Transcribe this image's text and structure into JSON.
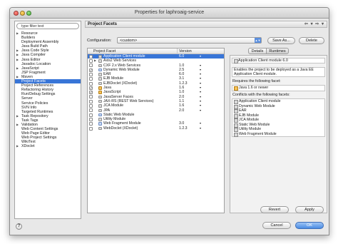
{
  "window": {
    "title": "Properties for laphroaig-service"
  },
  "filter": {
    "value": "type filter text"
  },
  "nav": {
    "items": [
      {
        "label": "Resource",
        "expandable": true
      },
      {
        "label": "Builders"
      },
      {
        "label": "Deployment Assembly"
      },
      {
        "label": "Java Build Path"
      },
      {
        "label": "Java Code Style",
        "expandable": true
      },
      {
        "label": "Java Compiler",
        "expandable": true
      },
      {
        "label": "Java Editor",
        "expandable": true
      },
      {
        "label": "Javadoc Location"
      },
      {
        "label": "JavaScript",
        "expandable": true
      },
      {
        "label": "JSP Fragment"
      },
      {
        "label": "Maven",
        "expandable": true
      },
      {
        "label": "Project Facets",
        "selected": true
      },
      {
        "label": "Project References"
      },
      {
        "label": "Refactoring History"
      },
      {
        "label": "Run/Debug Settings"
      },
      {
        "label": "Server"
      },
      {
        "label": "Service Policies"
      },
      {
        "label": "SVN Info"
      },
      {
        "label": "Targeted Runtimes"
      },
      {
        "label": "Task Repository",
        "expandable": true
      },
      {
        "label": "Task Tags"
      },
      {
        "label": "Validation",
        "expandable": true
      },
      {
        "label": "Web Content Settings"
      },
      {
        "label": "Web Page Editor"
      },
      {
        "label": "Web Project Settings"
      },
      {
        "label": "WikiText"
      },
      {
        "label": "XDoclet",
        "expandable": true
      }
    ]
  },
  "main": {
    "section_title": "Project Facets",
    "nav_arrows": "⇦ ▾ ⇨ ▾",
    "config_label": "Configuration:",
    "config_value": "<custom>",
    "save_as_label": "Save As...",
    "delete_label": "Delete",
    "table": {
      "col_facet": "Project Facet",
      "col_version": "Version",
      "rows": [
        {
          "label": "Application Client module",
          "version": "6.0",
          "checked": false,
          "selected": true,
          "icon": "facet-icon"
        },
        {
          "label": "Axis2 Web Services",
          "version": "",
          "checked": false,
          "expandable": true,
          "icon": "folder-icon"
        },
        {
          "label": "CXF 2.x Web Services",
          "version": "1.0",
          "checked": false,
          "icon": "facet-icon"
        },
        {
          "label": "Dynamic Web Module",
          "version": "2.5",
          "checked": true,
          "icon": "web-icon"
        },
        {
          "label": "EAR",
          "version": "6.0",
          "checked": false,
          "icon": "facet-icon"
        },
        {
          "label": "EJB Module",
          "version": "3.1",
          "checked": false,
          "icon": "facet-icon"
        },
        {
          "label": "EJBDoclet (XDoclet)",
          "version": "1.2.3",
          "checked": false,
          "icon": "facet-icon"
        },
        {
          "label": "Java",
          "version": "1.6",
          "checked": true,
          "icon": "java-icon"
        },
        {
          "label": "JavaScript",
          "version": "1.0",
          "checked": true,
          "icon": "java-icon"
        },
        {
          "label": "JavaServer Faces",
          "version": "2.0",
          "checked": false,
          "icon": "facet-icon"
        },
        {
          "label": "JAX-RS (REST Web Services)",
          "version": "1.1",
          "checked": false,
          "icon": "facet-icon"
        },
        {
          "label": "JCA Module",
          "version": "1.6",
          "checked": false,
          "icon": "facet-icon"
        },
        {
          "label": "JPA",
          "version": "2.0",
          "checked": false,
          "icon": "facet-icon"
        },
        {
          "label": "Static Web Module",
          "version": "",
          "checked": false,
          "icon": "web-icon"
        },
        {
          "label": "Utility Module",
          "version": "",
          "checked": false,
          "icon": "facet-icon"
        },
        {
          "label": "Web Fragment Module",
          "version": "3.0",
          "checked": false,
          "icon": "web-icon"
        },
        {
          "label": "WebDoclet (XDoclet)",
          "version": "1.2.3",
          "checked": false,
          "icon": "facet-icon"
        }
      ]
    },
    "details": {
      "tab_details": "Details",
      "tab_runtimes": "Runtimes",
      "heading": "Application Client module 6.0",
      "description": "Enables the project to be deployed as a Java EE Application Client module.",
      "requires_label": "Requires the following facet:",
      "requires_item": "Java 1.6 or newer",
      "conflicts_label": "Conflicts with the following facets:",
      "conflicts": [
        "Application Client module",
        "Dynamic Web Module",
        "EAR",
        "EJB Module",
        "JCA Module",
        "Static Web Module",
        "Utility Module",
        "Web Fragment Module"
      ]
    },
    "revert_label": "Revert",
    "apply_label": "Apply"
  },
  "footer": {
    "help_label": "?",
    "cancel_label": "Cancel",
    "ok_label": "OK"
  }
}
